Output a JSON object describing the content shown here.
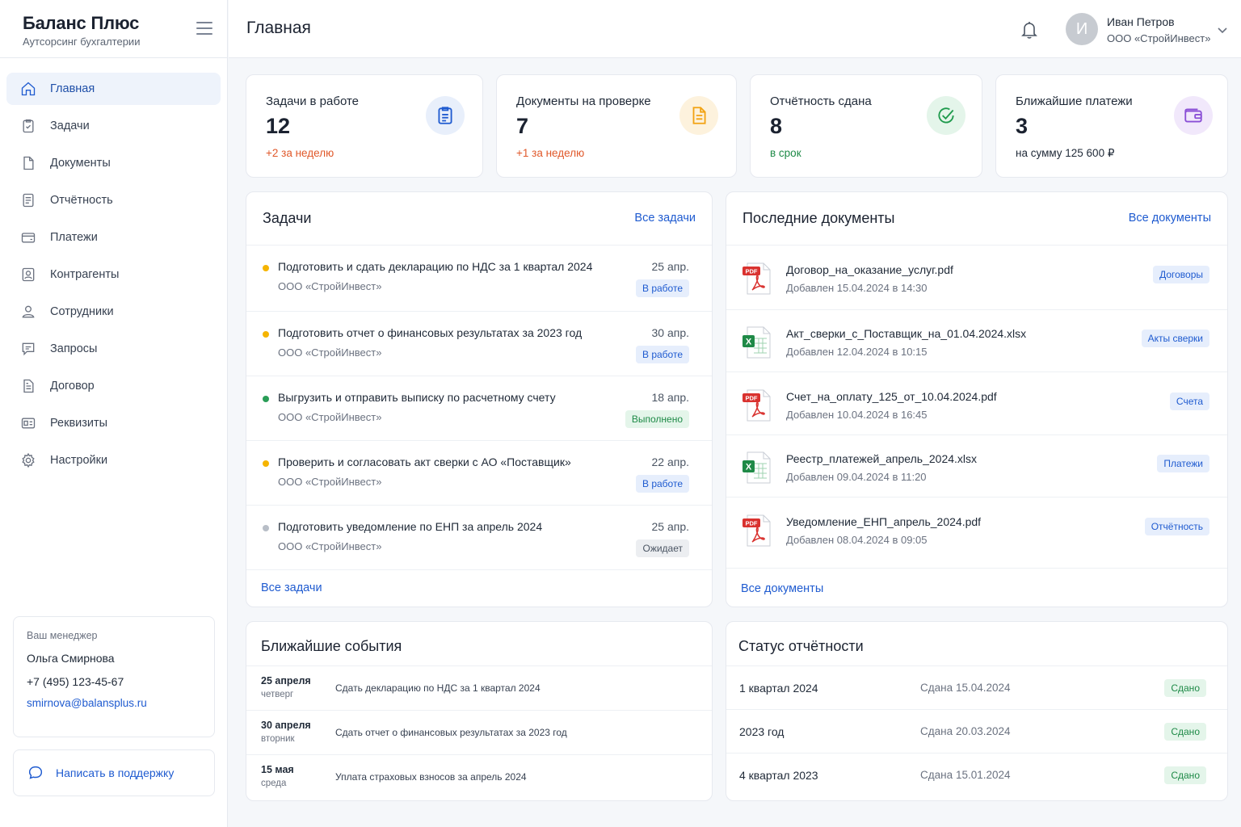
{
  "brand": {
    "title": "Баланс Плюс",
    "subtitle": "Аутсорсинг бухгалтерии"
  },
  "nav": {
    "items": [
      {
        "label": "Главная",
        "icon": "home-icon",
        "active": true
      },
      {
        "label": "Задачи",
        "icon": "clipboard-check-icon"
      },
      {
        "label": "Документы",
        "icon": "file-icon"
      },
      {
        "label": "Отчётность",
        "icon": "report-icon"
      },
      {
        "label": "Платежи",
        "icon": "card-icon"
      },
      {
        "label": "Контрагенты",
        "icon": "contact-icon"
      },
      {
        "label": "Сотрудники",
        "icon": "users-icon"
      },
      {
        "label": "Запросы",
        "icon": "message-icon"
      },
      {
        "label": "Договор",
        "icon": "contract-icon"
      },
      {
        "label": "Реквизиты",
        "icon": "id-card-icon"
      },
      {
        "label": "Настройки",
        "icon": "gear-icon"
      }
    ]
  },
  "manager": {
    "label": "Ваш менеджер",
    "name": "Ольга Смирнова",
    "phone": "+7 (495) 123-45-67",
    "email": "smirnova@balansplus.ru"
  },
  "support": {
    "label": "Написать в поддержку"
  },
  "header": {
    "title": "Главная",
    "user_initial": "И",
    "user_name": "Иван Петров",
    "user_org": "ООО «СтройИнвест»"
  },
  "stats": [
    {
      "label": "Задачи в работе",
      "value": "12",
      "note": "+2 за неделю",
      "note_color": "#e0582a",
      "icon": "clipboard-icon",
      "icon_color": "#1f5bd0",
      "icon_bg": "#e8effb"
    },
    {
      "label": "Документы на проверке",
      "value": "7",
      "note": "+1 за неделю",
      "note_color": "#e0582a",
      "icon": "document-icon",
      "icon_color": "#f2a313",
      "icon_bg": "#fdf2dd"
    },
    {
      "label": "Отчётность сдана",
      "value": "8",
      "note": "в срок",
      "note_color": "#1e8a47",
      "icon": "check-icon",
      "icon_color": "#1e9a4c",
      "icon_bg": "#e4f5ea"
    },
    {
      "label": "Ближайшие платежи",
      "value": "3",
      "note": "на сумму 125 600 ₽",
      "note_color": "#1f2937",
      "icon": "wallet-icon",
      "icon_color": "#8a4fd6",
      "icon_bg": "#f1e8fb"
    }
  ],
  "tasks": {
    "title": "Задачи",
    "all_link": "Все задачи",
    "footer_link": "Все задачи",
    "items": [
      {
        "title": "Подготовить и сдать декларацию по НДС за 1 квартал 2024",
        "org": "ООО «СтройИнвест»",
        "date": "25 апр.",
        "status": "В работе",
        "kind": "blue",
        "dot": "#f5b400"
      },
      {
        "title": "Подготовить отчет о финансовых результатах за 2023 год",
        "org": "ООО «СтройИнвест»",
        "date": "30 апр.",
        "status": "В работе",
        "kind": "blue",
        "dot": "#f5b400"
      },
      {
        "title": "Выгрузить и отправить выписку по расчетному счету",
        "org": "ООО «СтройИнвест»",
        "date": "18 апр.",
        "status": "Выполнено",
        "kind": "green",
        "dot": "#2a9d57"
      },
      {
        "title": "Проверить и согласовать акт сверки с АО «Поставщик»",
        "org": "ООО «СтройИнвест»",
        "date": "22 апр.",
        "status": "В работе",
        "kind": "blue",
        "dot": "#f5b400"
      },
      {
        "title": "Подготовить уведомление по ЕНП за апрель 2024",
        "org": "ООО «СтройИнвест»",
        "date": "25 апр.",
        "status": "Ожидает",
        "kind": "gray",
        "dot": "#b8bec7"
      }
    ]
  },
  "documents": {
    "title": "Последние документы",
    "all_link": "Все документы",
    "footer_link": "Все документы",
    "items": [
      {
        "name": "Договор_на_оказание_услуг.pdf",
        "added": "Добавлен 15.04.2024 в 14:30",
        "tag": "Договоры",
        "type": "pdf",
        "type_label": "PDF"
      },
      {
        "name": "Акт_сверки_с_Поставщик_на_01.04.2024.xlsx",
        "added": "Добавлен 12.04.2024 в 10:15",
        "tag": "Акты сверки",
        "type": "xlsx",
        "type_label": "X"
      },
      {
        "name": "Счет_на_оплату_125_от_10.04.2024.pdf",
        "added": "Добавлен 10.04.2024 в 16:45",
        "tag": "Счета",
        "type": "pdf",
        "type_label": "PDF"
      },
      {
        "name": "Реестр_платежей_апрель_2024.xlsx",
        "added": "Добавлен 09.04.2024 в 11:20",
        "tag": "Платежи",
        "type": "xlsx",
        "type_label": "X"
      },
      {
        "name": "Уведомление_ЕНП_апрель_2024.pdf",
        "added": "Добавлен 08.04.2024 в 09:05",
        "tag": "Отчётность",
        "type": "pdf",
        "type_label": "PDF"
      }
    ]
  },
  "events": {
    "title": "Ближайшие события",
    "items": [
      {
        "date": "25 апреля",
        "day": "четверг",
        "text": "Сдать декларацию по НДС за 1 квартал 2024"
      },
      {
        "date": "30 апреля",
        "day": "вторник",
        "text": "Сдать отчет о финансовых результатах за 2023 год"
      },
      {
        "date": "15 мая",
        "day": "среда",
        "text": "Уплата страховых взносов за апрель 2024"
      }
    ]
  },
  "reporting": {
    "title": "Статус отчётности",
    "items": [
      {
        "period": "1 квартал 2024",
        "label": "Сдана",
        "date": "15.04.2024",
        "status": "Сдано"
      },
      {
        "period": "2023 год",
        "label": "Сдана",
        "date": "20.03.2024",
        "status": "Сдано"
      },
      {
        "period": "4 квартал 2023",
        "label": "Сдана",
        "date": "15.01.2024",
        "status": "Сдано"
      }
    ]
  }
}
